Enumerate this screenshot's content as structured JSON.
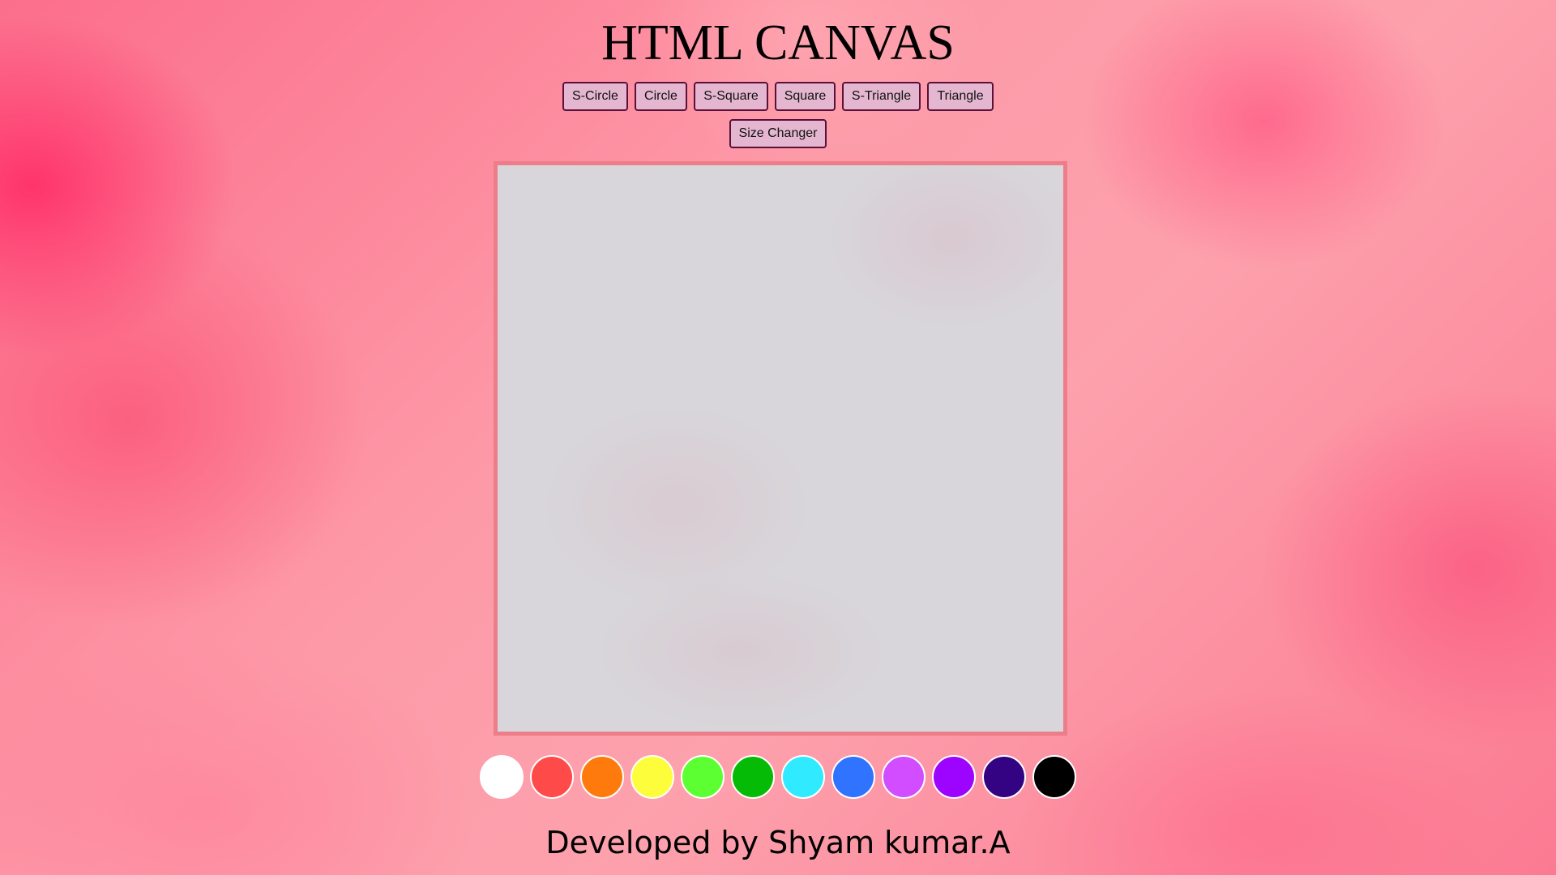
{
  "page": {
    "title": "HTML CANVAS",
    "footer": "Developed by Shyam kumar.A"
  },
  "toolbar": {
    "buttons": [
      {
        "label": "S-Circle"
      },
      {
        "label": "Circle"
      },
      {
        "label": "S-Square"
      },
      {
        "label": "Square"
      },
      {
        "label": "S-Triangle"
      },
      {
        "label": "Triangle"
      }
    ],
    "size_changer_label": "Size Changer"
  },
  "palette": {
    "colors": [
      {
        "name": "white",
        "hex": "#ffffff"
      },
      {
        "name": "red",
        "hex": "#ff4a4a"
      },
      {
        "name": "orange",
        "hex": "#ff7a0d"
      },
      {
        "name": "yellow",
        "hex": "#fdfd3c"
      },
      {
        "name": "light-green",
        "hex": "#5cff32"
      },
      {
        "name": "green",
        "hex": "#06bb06"
      },
      {
        "name": "cyan",
        "hex": "#30ebff"
      },
      {
        "name": "blue",
        "hex": "#2f73ff"
      },
      {
        "name": "light-purple",
        "hex": "#d24dff"
      },
      {
        "name": "purple",
        "hex": "#9d04ff"
      },
      {
        "name": "indigo",
        "hex": "#330384"
      },
      {
        "name": "black",
        "hex": "#000000"
      }
    ]
  },
  "colors": {
    "button_bg": "#e5b6d0",
    "button_border": "#5a1038",
    "canvas_border": "#ee7d8a",
    "canvas_bg": "#d8d6da"
  }
}
